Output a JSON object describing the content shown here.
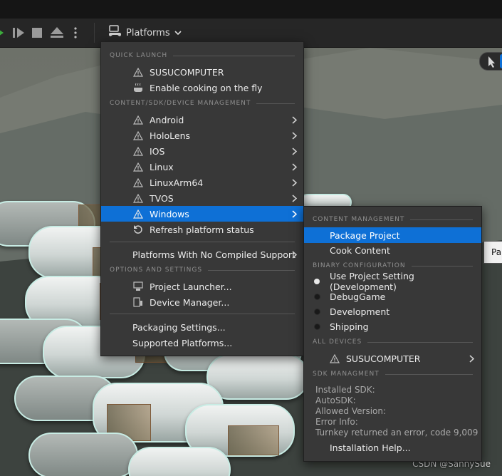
{
  "toolbar": {
    "platforms_label": "Platforms"
  },
  "tooltip": {
    "text": "Pa"
  },
  "watermark": "CSDN @SannySue",
  "menu": {
    "quick_launch_header": "QUICK LAUNCH",
    "quick_launch": [
      {
        "label": "SUSUCOMPUTER",
        "icon": "warning-icon"
      },
      {
        "label": "Enable cooking on the fly",
        "icon": "cooking-icon"
      }
    ],
    "device_mgmt_header": "CONTENT/SDK/DEVICE MANAGEMENT",
    "platforms": [
      {
        "label": "Android",
        "icon": "warning-icon"
      },
      {
        "label": "HoloLens",
        "icon": "warning-icon"
      },
      {
        "label": "IOS",
        "icon": "warning-icon"
      },
      {
        "label": "Linux",
        "icon": "warning-icon"
      },
      {
        "label": "LinuxArm64",
        "icon": "warning-icon"
      },
      {
        "label": "TVOS",
        "icon": "warning-icon"
      },
      {
        "label": "Windows",
        "icon": "warning-icon",
        "highlighted": true
      }
    ],
    "refresh_label": "Refresh platform status",
    "no_compiled_label": "Platforms With No Compiled Support",
    "options_header": "OPTIONS AND SETTINGS",
    "project_launcher_label": "Project Launcher...",
    "device_manager_label": "Device Manager...",
    "packaging_settings_label": "Packaging Settings...",
    "supported_platforms_label": "Supported Platforms..."
  },
  "submenu": {
    "content_mgmt_header": "CONTENT MANAGEMENT",
    "package_project_label": "Package Project",
    "cook_content_label": "Cook Content",
    "binary_config_header": "BINARY CONFIGURATION",
    "binary_configs": [
      {
        "label": "Use Project Setting (Development)",
        "selected": true
      },
      {
        "label": "DebugGame",
        "selected": false
      },
      {
        "label": "Development",
        "selected": false
      },
      {
        "label": "Shipping",
        "selected": false
      }
    ],
    "all_devices_header": "ALL DEVICES",
    "device_label": "SUSUCOMPUTER",
    "sdk_header": "SDK MANAGMENT",
    "sdk_info": [
      "Installed SDK:",
      "AutoSDK:",
      "Allowed Version:",
      "Error Info:",
      "Turnkey returned an error, code 9,009"
    ],
    "installation_help_label": "Installation Help..."
  },
  "colors": {
    "highlight": "#0e70d6",
    "menu_bg": "#383838",
    "toolbar_bg": "#262626"
  }
}
